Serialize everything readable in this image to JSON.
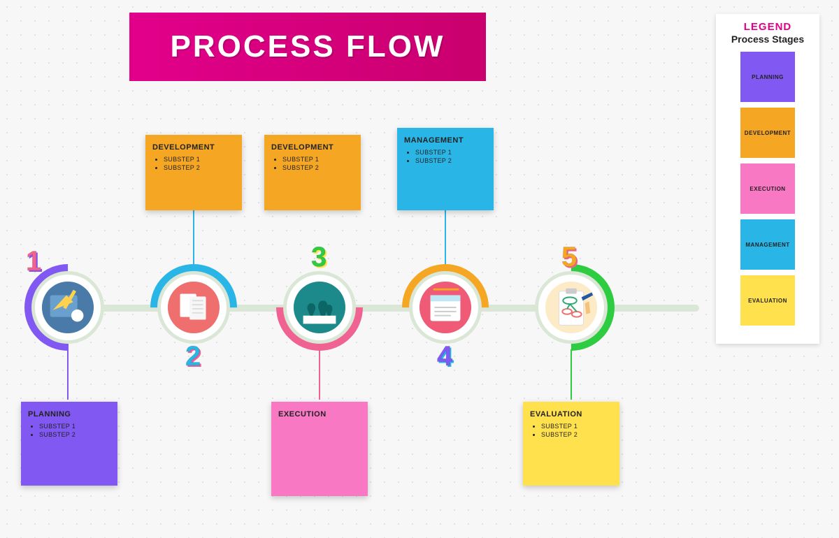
{
  "title": "PROCESS FLOW",
  "legend": {
    "title": "LEGEND",
    "subtitle": "Process Stages",
    "items": [
      {
        "label": "PLANNING",
        "color": "#8159f2"
      },
      {
        "label": "DEVELOPMENT",
        "color": "#f5a623"
      },
      {
        "label": "EXECUTION",
        "color": "#f978c3"
      },
      {
        "label": "MANAGEMENT",
        "color": "#29b6e6"
      },
      {
        "label": "EVALUATION",
        "color": "#ffe14d"
      }
    ]
  },
  "stages": [
    {
      "n": "1",
      "title": "PLANNING",
      "substeps": [
        "SUBSTEP 1",
        "SUBSTEP 2"
      ],
      "card_color": "#8159f2",
      "card_pos": "below",
      "icon": "plan"
    },
    {
      "n": "2",
      "title": "DEVELOPMENT",
      "substeps": [
        "SUBSTEP 1",
        "SUBSTEP 2"
      ],
      "card_color": "#f5a623",
      "card_pos": "above",
      "icon": "docs",
      "extra_card": {
        "title": "DEVELOPMENT",
        "substeps": [
          "SUBSTEP 1",
          "SUBSTEP 2"
        ],
        "color": "#f5a623"
      }
    },
    {
      "n": "3",
      "title": "EXECUTION",
      "substeps": [],
      "card_color": "#f978c3",
      "card_pos": "below",
      "icon": "chess"
    },
    {
      "n": "4",
      "title": "MANAGEMENT",
      "substeps": [
        "SUBSTEP 1",
        "SUBSTEP 2"
      ],
      "card_color": "#29b6e6",
      "card_pos": "above",
      "icon": "window"
    },
    {
      "n": "5",
      "title": "EVALUATION",
      "substeps": [
        "SUBSTEP 1",
        "SUBSTEP 2"
      ],
      "card_color": "#ffe14d",
      "card_pos": "below",
      "icon": "clipboard"
    }
  ]
}
